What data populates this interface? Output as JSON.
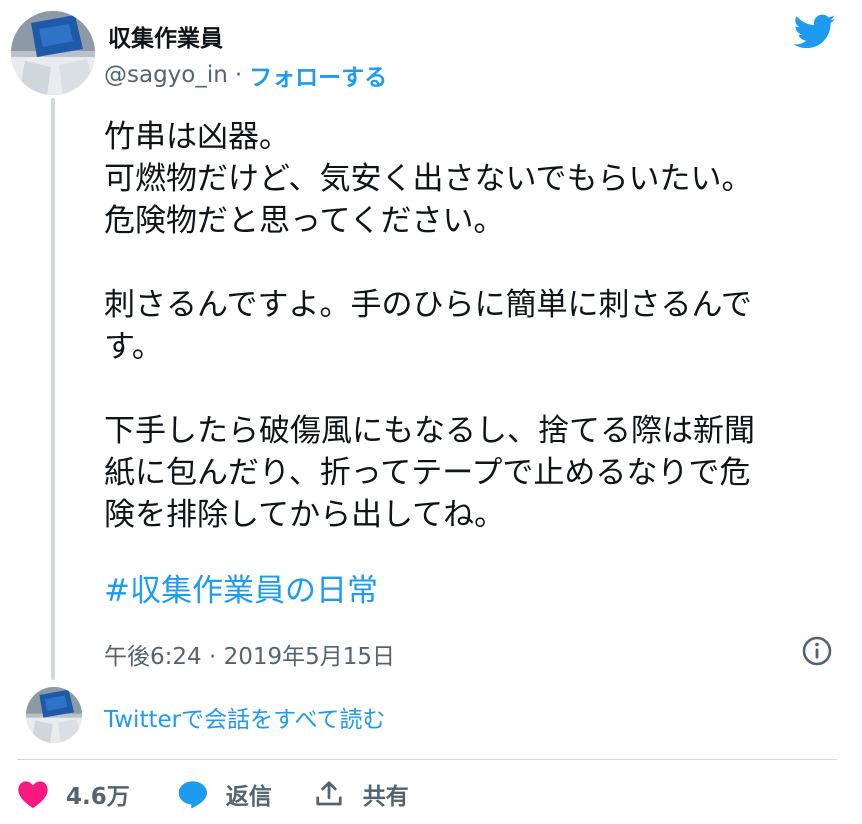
{
  "colors": {
    "accent": "#1d9bf0",
    "text": "#0f1419",
    "secondary": "#536471",
    "like": "#f91880",
    "divider": "#cfd9de"
  },
  "author": {
    "display_name": "収集作業員",
    "handle": "@sagyo_in",
    "separator": "·",
    "follow_label": "フォローする",
    "avatar": "avatar-photo",
    "platform_icon": "twitter-bird-icon"
  },
  "tweet": {
    "paragraphs": [
      [
        "竹串は凶器。",
        "可燃物だけど、気安く出さないでもらいたい。",
        "危険物だと思ってください。"
      ],
      [
        "刺さるんですよ。手のひらに簡単に刺さるんで",
        "す。"
      ],
      [
        "下手したら破傷風にもなるし、捨てる際は新聞",
        "紙に包んだり、折ってテープで止めるなりで危",
        "険を排除してから出してね。"
      ]
    ],
    "hashtag": "#収集作業員の日常",
    "timestamp": "午後6:24 · 2019年5月15日",
    "info_icon": "info-icon"
  },
  "conversation": {
    "link_label": "Twitterで会話をすべて読む"
  },
  "actions": {
    "like_count": "4.6万",
    "reply_label": "返信",
    "share_label": "共有",
    "icons": [
      "heart-icon",
      "reply-bubble-icon",
      "share-icon"
    ]
  }
}
